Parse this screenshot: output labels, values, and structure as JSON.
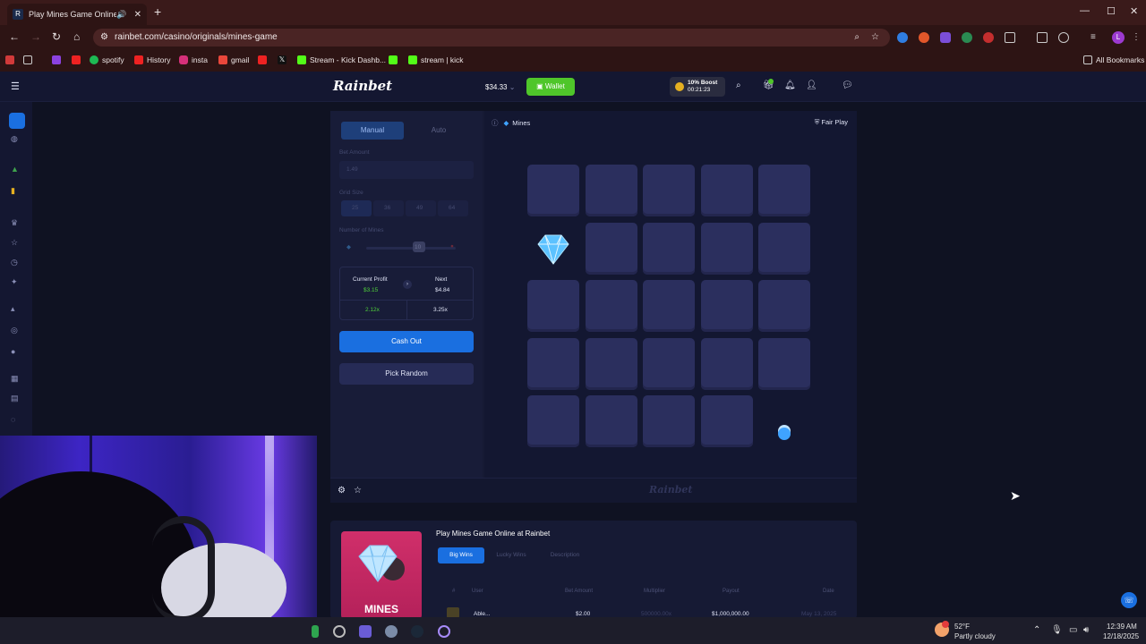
{
  "browser": {
    "tab_title": "Play Mines Game Online at",
    "url": "rainbet.com/casino/originals/mines-game",
    "bookmarks": [
      "spotify",
      "History",
      "insta",
      "gmail",
      "Stream - Kick Dashb...",
      "stream | kick"
    ],
    "all_bookmarks": "All Bookmarks",
    "profile_initial": "L"
  },
  "header": {
    "logo": "Rainbet",
    "balance": "$34.33",
    "wallet_label": "Wallet",
    "boost_title": "10% Boost",
    "boost_timer": "00:21:23"
  },
  "controls": {
    "tab_manual": "Manual",
    "tab_auto": "Auto",
    "bet_amount_label": "Bet Amount",
    "bet_amount_value": "1.49",
    "grid_size_label": "Grid Size",
    "grid_sizes": [
      "25",
      "36",
      "49",
      "64"
    ],
    "mines_label": "Number of Mines",
    "mines_value": "10",
    "current_profit_label": "Current Profit",
    "current_profit_value": "$3.15",
    "next_label": "Next",
    "next_value": "$4.84",
    "current_multiplier": "2.12x",
    "next_multiplier": "3.25x",
    "cashout_label": "Cash Out",
    "pick_random_label": "Pick Random"
  },
  "game": {
    "title": "Mines",
    "fair_play": "Fair Play",
    "watermark": "Rainbet",
    "grid_size": 5,
    "revealed_gems": [
      [
        1,
        0
      ]
    ],
    "pending_tile": [
      4,
      4
    ]
  },
  "info": {
    "title": "Play Mines Game Online at Rainbet",
    "tabs": [
      "Big Wins",
      "Lucky Wins",
      "Description"
    ],
    "thumb_label": "MINES",
    "columns": [
      "#",
      "User",
      "Bet Amount",
      "Multiplier",
      "Payout",
      "Date"
    ],
    "row": {
      "user": "Able...",
      "bet": "$2.00",
      "multiplier": "500000.00x",
      "payout": "$1,000,000.00",
      "date": "May 13, 2025"
    }
  },
  "taskbar": {
    "weather_temp": "52°F",
    "weather_desc": "Partly cloudy",
    "time": "12:39 AM",
    "date": "12/18/2025"
  },
  "colors": {
    "accent_blue": "#1a6fe0",
    "wallet_green": "#4fc62a",
    "profit_green": "#4fd13a"
  }
}
